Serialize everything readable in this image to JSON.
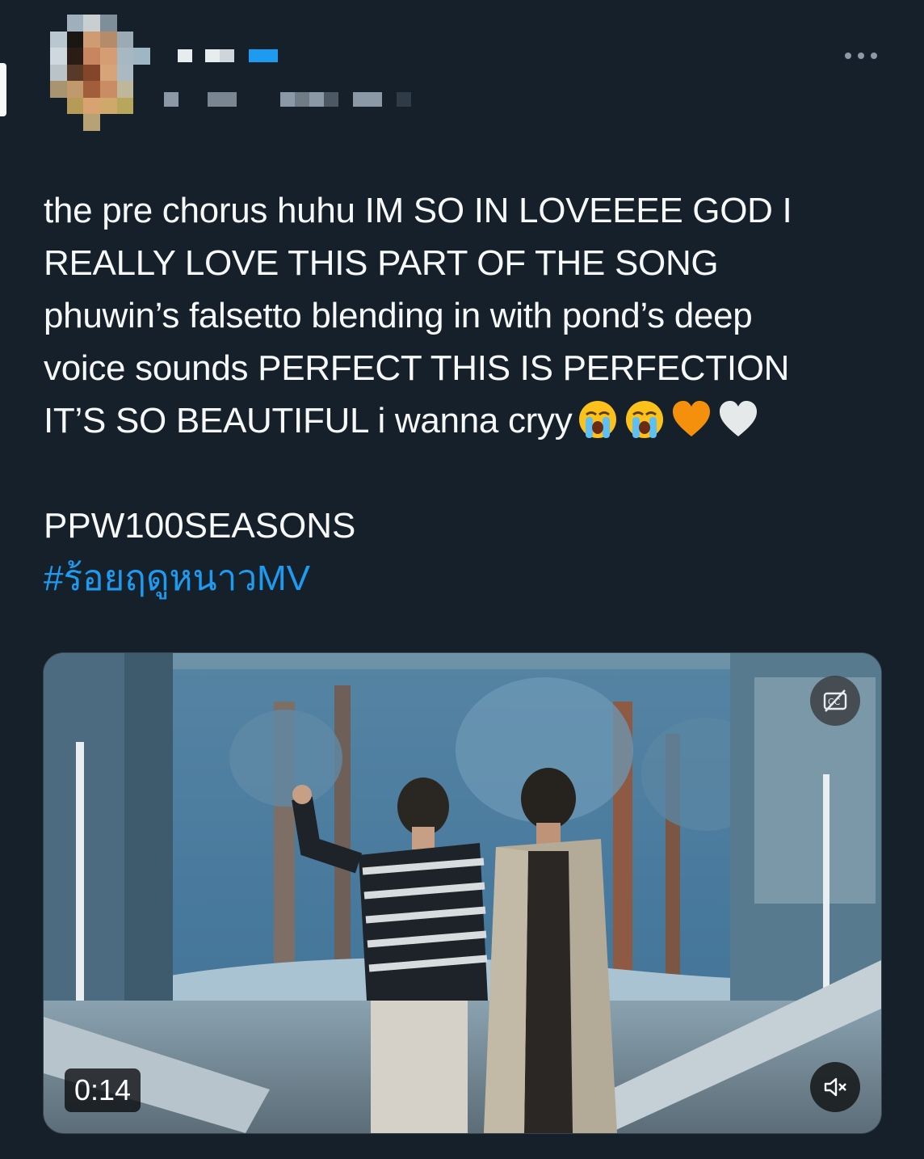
{
  "tweet": {
    "text": "the pre chorus huhu IM SO IN LOVEEEE GOD I\nREALLY LOVE THIS PART OF THE SONG\nphuwin’s falsetto blending in with pond’s deep\nvoice sounds PERFECT THIS IS PERFECTION\nIT’S SO BEAUTIFUL i wanna cryy",
    "emojis": [
      "loudly-crying-face-icon",
      "loudly-crying-face-icon",
      "orange-heart-icon",
      "white-heart-icon"
    ],
    "plain_tag": "PPW100SEASONS",
    "hashtag": "#ร้อยฤดูหนาวMV"
  },
  "video": {
    "elapsed": "0:14",
    "captions_icon": "closed-captions-off-icon",
    "volume_icon": "muted-speaker-icon"
  },
  "colors": {
    "background": "#15202b",
    "text": "#f7f9f9",
    "hashtag": "#1d9bf0",
    "secondary": "#8b98a5"
  }
}
